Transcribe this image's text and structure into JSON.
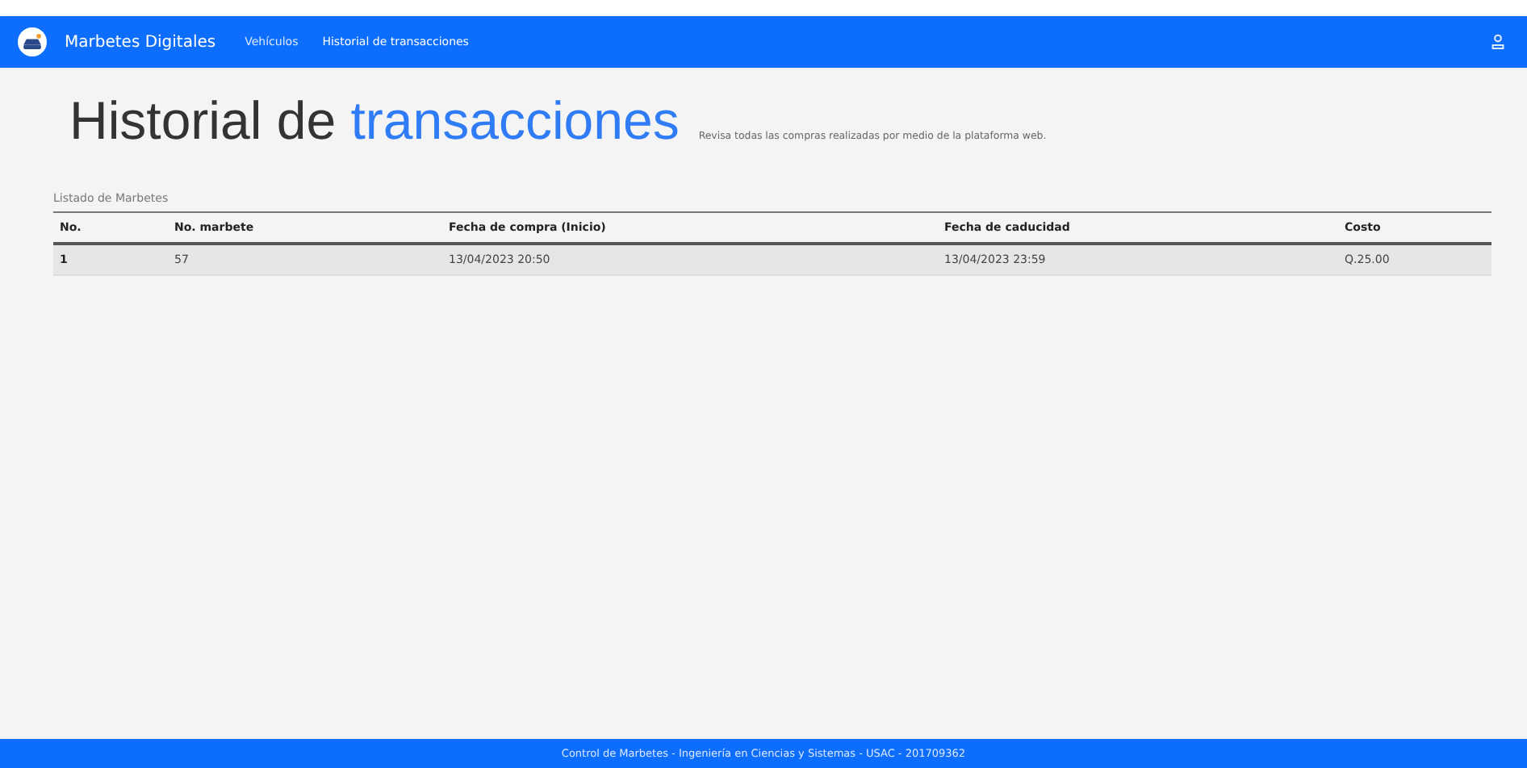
{
  "navbar": {
    "brand": "Marbetes Digitales",
    "links": [
      {
        "label": "Vehículos",
        "selected": false
      },
      {
        "label": "Historial de transacciones",
        "selected": true
      }
    ]
  },
  "header": {
    "title": "Historial de",
    "title_accent": "transacciones",
    "subtitle": "Revisa todas las compras realizadas por medio de la plataforma web."
  },
  "table": {
    "caption": "Listado de Marbetes",
    "columns": [
      "No.",
      "No. marbete",
      "Fecha de compra (Inicio)",
      "Fecha de caducidad",
      "Costo"
    ],
    "rows": [
      [
        "1",
        "57",
        "13/04/2023 20:50",
        "13/04/2023 23:59",
        "Q.25.00"
      ]
    ]
  },
  "footer": "Control de Marbetes - Ingeniería en Ciencias y Sistemas - USAC - 201709362"
}
